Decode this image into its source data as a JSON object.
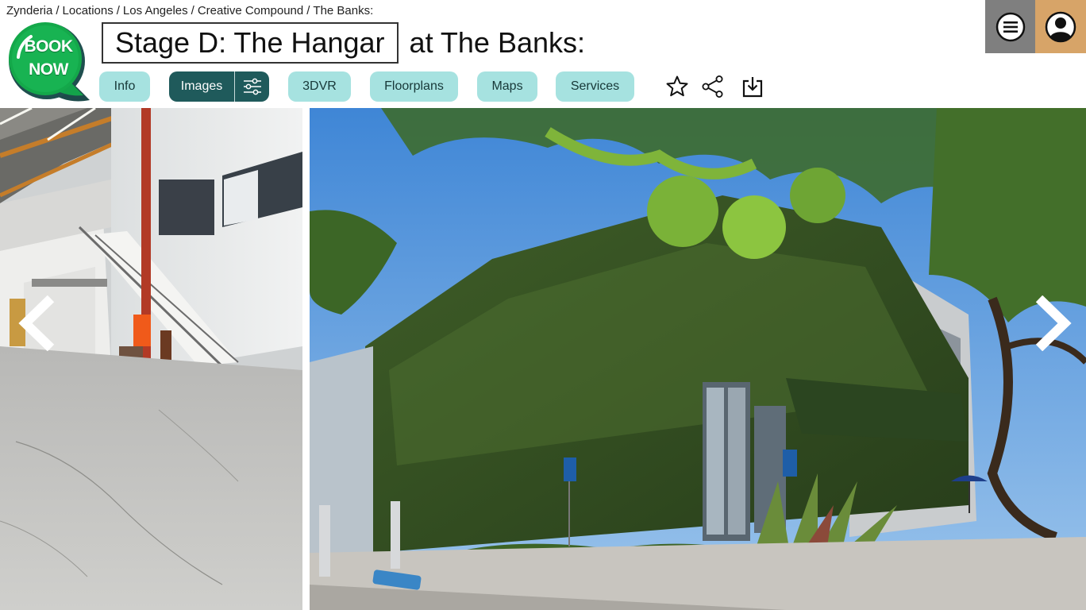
{
  "breadcrumb": [
    "Zynderia",
    "Locations",
    "Los Angeles",
    "Creative Compound",
    "The Banks:"
  ],
  "book_now": {
    "line1": "BOOK",
    "line2": "NOW",
    "color": "#14a84a"
  },
  "title": {
    "stage": "Stage D: The Hangar",
    "suffix": "at The Banks:"
  },
  "header_buttons": {
    "menu_icon": "hamburger-menu-icon",
    "profile_icon": "user-profile-icon",
    "menu_color": "#7f7f7f",
    "profile_color": "#d7a468"
  },
  "tabs": [
    {
      "label": "Info",
      "active": false
    },
    {
      "label": "Images",
      "active": true,
      "extra_icon": "filter-sliders-icon"
    },
    {
      "label": "3DVR",
      "active": false
    },
    {
      "label": "Floorplans",
      "active": false
    },
    {
      "label": "Maps",
      "active": false
    },
    {
      "label": "Services",
      "active": false
    }
  ],
  "actions": [
    "star-icon",
    "share-icon",
    "download-icon"
  ],
  "colors": {
    "tab_bg": "#a6e2e0",
    "tab_active_bg": "#1f5a5b"
  },
  "gallery": {
    "photos": [
      "warehouse-interior-photo",
      "ivy-covered-building-photo"
    ],
    "controls": [
      "previous-arrow-icon",
      "next-arrow-icon"
    ]
  }
}
